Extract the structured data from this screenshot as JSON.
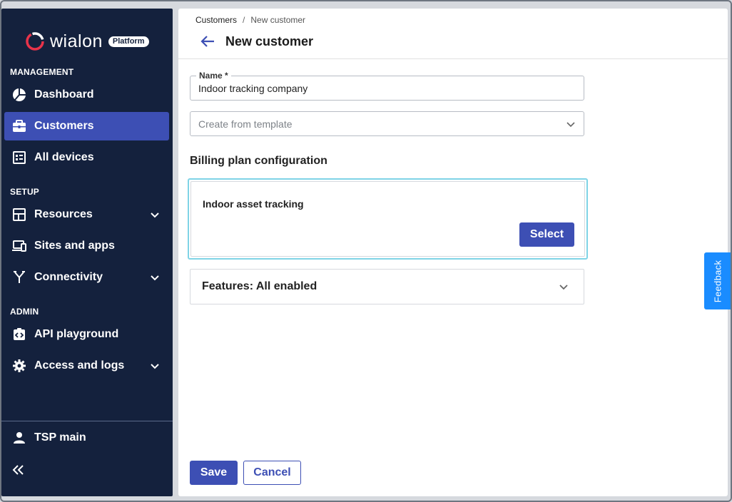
{
  "brand": {
    "name": "wialon",
    "badge": "Platform"
  },
  "sidebar": {
    "sections": [
      {
        "label": "MANAGEMENT"
      },
      {
        "label": "SETUP"
      },
      {
        "label": "ADMIN"
      }
    ],
    "items": [
      {
        "label": "Dashboard",
        "icon": "dashboard-pie-icon"
      },
      {
        "label": "Customers",
        "icon": "briefcase-icon",
        "active": true
      },
      {
        "label": "All devices",
        "icon": "devices-list-icon"
      },
      {
        "label": "Resources",
        "icon": "resources-layout-icon",
        "expandable": true
      },
      {
        "label": "Sites and apps",
        "icon": "sites-devices-icon"
      },
      {
        "label": "Connectivity",
        "icon": "connectivity-fork-icon",
        "expandable": true
      },
      {
        "label": "API playground",
        "icon": "api-code-icon"
      },
      {
        "label": "Access and logs",
        "icon": "gear-icon",
        "expandable": true
      }
    ],
    "user": {
      "label": "TSP main",
      "icon": "person-icon"
    },
    "collapse_icon": "double-chevron-left-icon"
  },
  "header": {
    "breadcrumb": {
      "parent": "Customers",
      "separator": "/",
      "current": "New customer"
    },
    "title": "New customer"
  },
  "form": {
    "name": {
      "legend": "Name *",
      "value": "Indoor tracking company"
    },
    "template": {
      "placeholder": "Create from template"
    },
    "billing_title": "Billing plan configuration",
    "plan": {
      "title": "Indoor asset tracking",
      "select_label": "Select"
    },
    "features_label": "Features: All enabled",
    "save_label": "Save",
    "cancel_label": "Cancel"
  },
  "feedback_label": "Feedback",
  "colors": {
    "sidebar_bg": "#14213d",
    "accent": "#3d4fb4",
    "feedback": "#1a8cff",
    "card_highlight": "#7fd4e6"
  }
}
